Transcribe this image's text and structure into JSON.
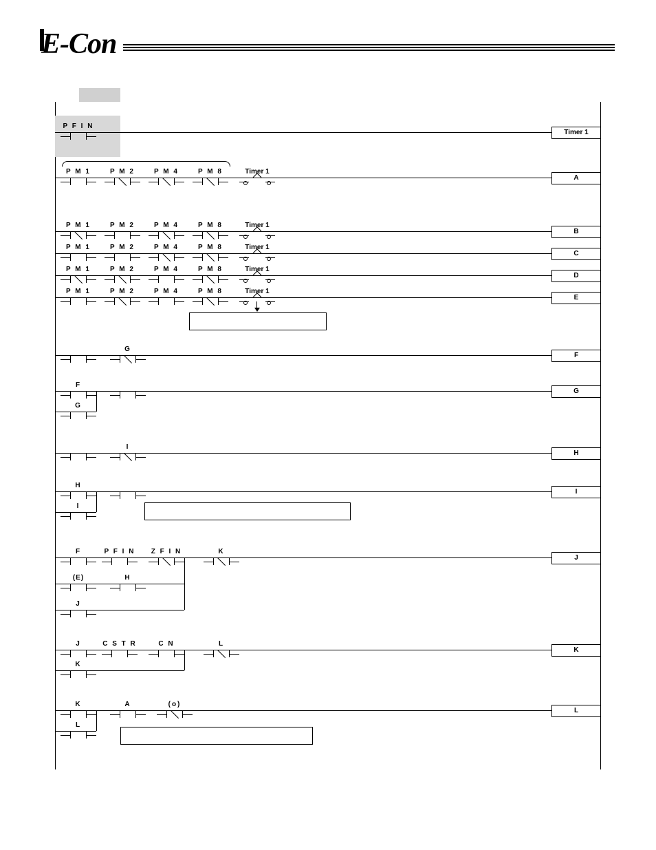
{
  "meta": {
    "domain": "Diagram",
    "type": "ladder-logic"
  },
  "logo": "E-Con",
  "labels": {
    "PFIN": "P F I N",
    "ZFIN": "Z F I N",
    "CSTR": "C S T R",
    "CN": "C N",
    "PM1": "P M 1",
    "PM2": "P M 2",
    "PM4": "P M 4",
    "PM8": "P M 8",
    "Timer1": "Timer   1",
    "A": "A",
    "B": "B",
    "C": "C",
    "D": "D",
    "E": "E",
    "F": "F",
    "G": "G",
    "H": "H",
    "I": "I",
    "J": "J",
    "K": "K",
    "L": "L",
    "E_paren": "(E)",
    "o_paren": "(o)"
  },
  "coils": {
    "timer1": "Timer   1",
    "A": "A",
    "B": "B",
    "C": "C",
    "D": "D",
    "E": "E",
    "F": "F",
    "G": "G",
    "H": "H",
    "I": "I",
    "J": "J",
    "K": "K",
    "L": "L"
  },
  "rungs": [
    {
      "id": "r1",
      "contacts": [
        {
          "name": "PFIN",
          "type": "no",
          "x": 0
        }
      ],
      "coil": "timer1"
    },
    {
      "id": "r2",
      "contacts": [
        {
          "name": "PM1",
          "type": "no",
          "x": 0
        },
        {
          "name": "PM2",
          "type": "nc",
          "x": 1
        },
        {
          "name": "PM4",
          "type": "nc",
          "x": 2
        },
        {
          "name": "PM8",
          "type": "nc",
          "x": 3
        },
        {
          "name": "Timer1",
          "type": "timer",
          "x": 4
        }
      ],
      "coil": "A"
    },
    {
      "id": "r3",
      "contacts": [
        {
          "name": "PM1",
          "type": "nc",
          "x": 0
        },
        {
          "name": "PM2",
          "type": "no",
          "x": 1
        },
        {
          "name": "PM4",
          "type": "nc",
          "x": 2
        },
        {
          "name": "PM8",
          "type": "nc",
          "x": 3
        },
        {
          "name": "Timer1",
          "type": "timer",
          "x": 4
        }
      ],
      "coil": "B"
    },
    {
      "id": "r4",
      "contacts": [
        {
          "name": "PM1",
          "type": "no",
          "x": 0
        },
        {
          "name": "PM2",
          "type": "no",
          "x": 1
        },
        {
          "name": "PM4",
          "type": "nc",
          "x": 2
        },
        {
          "name": "PM8",
          "type": "nc",
          "x": 3
        },
        {
          "name": "Timer1",
          "type": "timer",
          "x": 4
        }
      ],
      "coil": "C"
    },
    {
      "id": "r5",
      "contacts": [
        {
          "name": "PM1",
          "type": "nc",
          "x": 0
        },
        {
          "name": "PM2",
          "type": "nc",
          "x": 1
        },
        {
          "name": "PM4",
          "type": "no",
          "x": 2
        },
        {
          "name": "PM8",
          "type": "nc",
          "x": 3
        },
        {
          "name": "Timer1",
          "type": "timer",
          "x": 4
        }
      ],
      "coil": "D"
    },
    {
      "id": "r6",
      "contacts": [
        {
          "name": "PM1",
          "type": "no",
          "x": 0
        },
        {
          "name": "PM2",
          "type": "nc",
          "x": 1
        },
        {
          "name": "PM4",
          "type": "no",
          "x": 2
        },
        {
          "name": "PM8",
          "type": "nc",
          "x": 3
        },
        {
          "name": "Timer1",
          "type": "timer",
          "x": 4
        }
      ],
      "coil": "E"
    },
    {
      "id": "r7",
      "contacts": [
        {
          "name": "",
          "type": "no",
          "x": 0
        },
        {
          "name": "G",
          "type": "nc",
          "x": 1
        }
      ],
      "coil": "F"
    },
    {
      "id": "r8",
      "contacts": [
        {
          "name": "F",
          "type": "no",
          "x": 0
        },
        {
          "name": "",
          "type": "no",
          "x": 1
        }
      ],
      "coil": "G",
      "branches": [
        {
          "name": "G",
          "type": "no",
          "x": 0
        }
      ]
    },
    {
      "id": "r9",
      "contacts": [
        {
          "name": "",
          "type": "no",
          "x": 0
        },
        {
          "name": "I",
          "type": "nc",
          "x": 1
        }
      ],
      "coil": "H"
    },
    {
      "id": "r10",
      "contacts": [
        {
          "name": "H",
          "type": "no",
          "x": 0
        },
        {
          "name": "",
          "type": "no",
          "x": 1
        }
      ],
      "coil": "I",
      "branches": [
        {
          "name": "I",
          "type": "no",
          "x": 0
        }
      ]
    },
    {
      "id": "r11",
      "contacts": [
        {
          "name": "F",
          "type": "no",
          "x": 0
        },
        {
          "name": "PFIN",
          "type": "no",
          "x": 1
        },
        {
          "name": "ZFIN",
          "type": "nc",
          "x": 2
        },
        {
          "name": "K",
          "type": "nc",
          "x": 3
        }
      ],
      "coil": "J",
      "branches": [
        {
          "name": "E_paren",
          "type": "no",
          "x": 0
        },
        {
          "name": "H",
          "type": "no",
          "x": 1
        },
        {
          "name": "J",
          "type": "no",
          "x": 0
        }
      ]
    },
    {
      "id": "r12",
      "contacts": [
        {
          "name": "J",
          "type": "no",
          "x": 0
        },
        {
          "name": "CSTR",
          "type": "no",
          "x": 1
        },
        {
          "name": "CN",
          "type": "no",
          "x": 2
        },
        {
          "name": "L",
          "type": "nc",
          "x": 3
        }
      ],
      "coil": "K",
      "branches": [
        {
          "name": "K",
          "type": "no",
          "x": 0
        }
      ]
    },
    {
      "id": "r13",
      "contacts": [
        {
          "name": "K",
          "type": "no",
          "x": 0
        },
        {
          "name": "A",
          "type": "no",
          "x": 1
        },
        {
          "name": "o_paren",
          "type": "nc",
          "x": 2
        }
      ],
      "coil": "L",
      "branches": [
        {
          "name": "L",
          "type": "no",
          "x": 0
        }
      ]
    }
  ]
}
